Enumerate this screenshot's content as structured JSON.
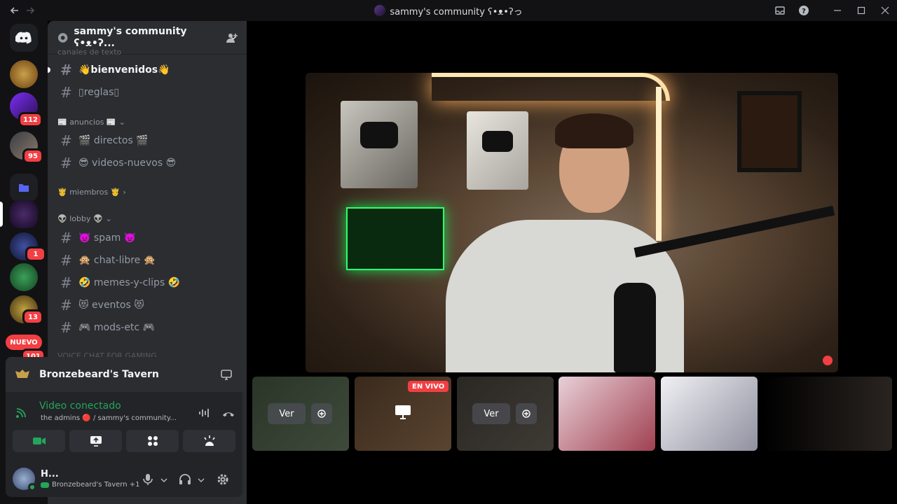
{
  "window": {
    "title": "sammy's community ʕ•ᴥ•ʔっ",
    "back_icon": "arrow-left-icon",
    "forward_icon": "arrow-right-icon"
  },
  "guilds": {
    "badges": [
      "112",
      "95",
      "1",
      "13",
      "101"
    ],
    "nuevo_label": "NUEVO"
  },
  "server": {
    "name": "sammy's community ʕ•ᴥ•ʔ...",
    "partial_category": "canales de texto"
  },
  "channels": [
    {
      "name": "👋bienvenidos👋",
      "unread": true
    },
    {
      "name": "▯reglas▯",
      "unread": false
    }
  ],
  "categories": [
    {
      "label": "📰 anuncios 📰",
      "chevron": "⌄"
    },
    {
      "label": "🤴 miembros 🤴",
      "chevron": "›"
    },
    {
      "label": "👽 lobby 👽",
      "chevron": "⌄"
    }
  ],
  "anuncios_channels": [
    "🎬 directos 🎬",
    "😎 videos-nuevos 😎"
  ],
  "lobby_channels": [
    "👿 spam 👿",
    "🙊 chat-libre 🙊",
    "🤣 memes-y-clips 🤣",
    "😻 eventos 😻",
    "🎮 mods-etc 🎮"
  ],
  "partial_voice_category": "VOICE CHAT FOR GAMING",
  "voice": {
    "channel_name": "Bronzebeard's Tavern",
    "status": "Video conectado",
    "location": "the admins 🔴 / sammy's community...",
    "buttons": [
      "camera-icon",
      "screen-share-icon",
      "activities-icon",
      "soundboard-icon"
    ]
  },
  "user": {
    "name": "H...",
    "activity": "Bronzebeard's Tavern +1"
  },
  "stream": {
    "view_label_1": "Ver",
    "view_label_2": "Ver",
    "live_label": "EN VIVO"
  },
  "colors": {
    "accent_green": "#23a55a",
    "danger_red": "#f23f43",
    "sidebar_bg": "#2b2d31",
    "guild_bg": "#121214"
  }
}
